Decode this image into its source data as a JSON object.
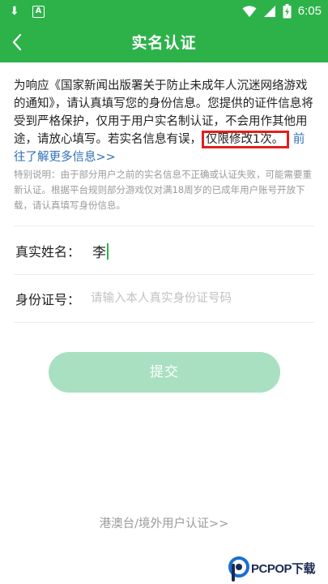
{
  "status_bar": {
    "time": "6:05",
    "left_icons": [
      "download-icon",
      "a-icon"
    ],
    "right_icons": [
      "wifi-icon",
      "signal-icon",
      "battery-icon"
    ],
    "a_glyph": "A",
    "download_glyph": "⬇"
  },
  "header": {
    "title": "实名认证",
    "back_icon": "chevron-left-icon"
  },
  "notice": {
    "text_part1": "为响应《国家新闻出版署关于防止未成年人沉迷网络游戏的通知》，请认真填写您的身份信息。您提供的证件信息将受到严格保护，仅用于用户实名制认证，不会用作其他用途，请放心填写。若实名信息有误，",
    "highlight": "仅限修改1次。",
    "link_text": "前往了解更多信息>>"
  },
  "special_note": "特别说明：由于部分用户之前的实名信息不正确或认证失败，可能需要重新认证。根据平台规则部分游戏仅对满18周岁的已成年用户账号开放下载，请认真填写身份信息。",
  "form": {
    "name_label": "真实姓名：",
    "name_value": "李",
    "id_label": "身份证号：",
    "id_placeholder": "请输入本人真实身份证号码"
  },
  "submit_label": "提交",
  "hk_link": "港澳台/境外用户认证>>",
  "watermark": {
    "text": "PCPOP下载"
  },
  "colors": {
    "primary_green": "#2db24a",
    "button_disabled": "#a9e0c1",
    "highlight_border": "#e0201e",
    "link_blue": "#2e6fb7"
  }
}
